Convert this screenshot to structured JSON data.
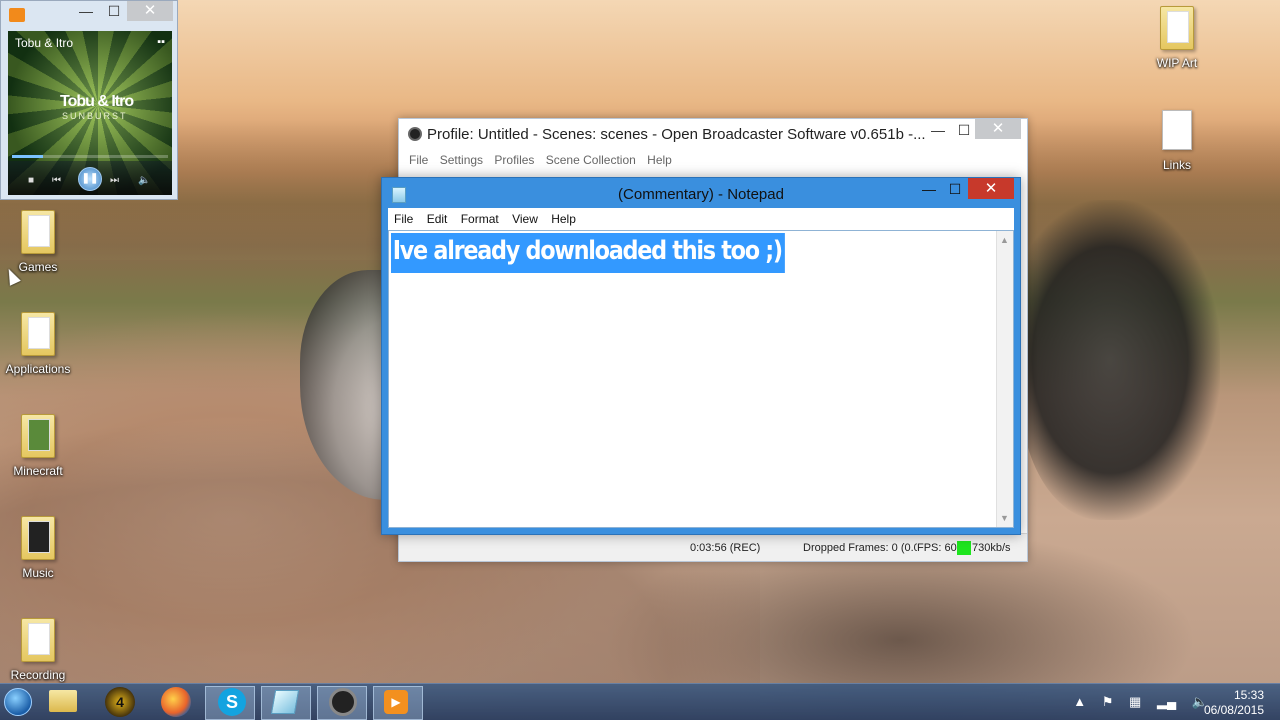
{
  "desktop": {
    "icons_left": [
      {
        "label": "Games"
      },
      {
        "label": "Applications"
      },
      {
        "label": "Minecraft"
      },
      {
        "label": "Music"
      },
      {
        "label": "Recording"
      }
    ],
    "icons_right": [
      {
        "label": "WIP Art"
      },
      {
        "label": "Links"
      }
    ]
  },
  "media_player": {
    "track": "Tobu & Itro",
    "art_title": "Tobu & Itro",
    "art_subtitle": "SUNBURST",
    "progress": 0.2,
    "minimize": "—",
    "maximize": "☐",
    "close": "✕",
    "controls": {
      "stop": "■",
      "prev": "⏮",
      "play_pause": "❚❚",
      "next": "⏭",
      "volume": "🔈"
    }
  },
  "obs": {
    "title": "Profile: Untitled - Scenes: scenes - Open Broadcaster Software v0.651b -...",
    "menu": [
      "File",
      "Settings",
      "Profiles",
      "Scene Collection",
      "Help"
    ],
    "status": {
      "time": "0:03:56 (REC)",
      "dropped": "Dropped Frames: 0 (0.0",
      "fps": "FPS: 60",
      "rate": "730kb/s",
      "indicator_color": "#1ee51e"
    },
    "minimize": "—",
    "maximize": "☐",
    "close": "✕"
  },
  "notepad": {
    "title": "(Commentary) - Notepad",
    "menu": [
      "File",
      "Edit",
      "Format",
      "View",
      "Help"
    ],
    "content": "Ive already downloaded this too ;)",
    "minimize": "—",
    "maximize": "☐",
    "close": "✕",
    "selection_color": "#3399ff"
  },
  "taskbar": {
    "l4d_label": "4",
    "skype_label": "S",
    "clock_time": "15:33",
    "clock_date": "06/08/2015",
    "tray_icons": [
      "up-arrow-icon",
      "flag-icon",
      "windows-icon",
      "signal-icon",
      "volume-icon"
    ]
  }
}
